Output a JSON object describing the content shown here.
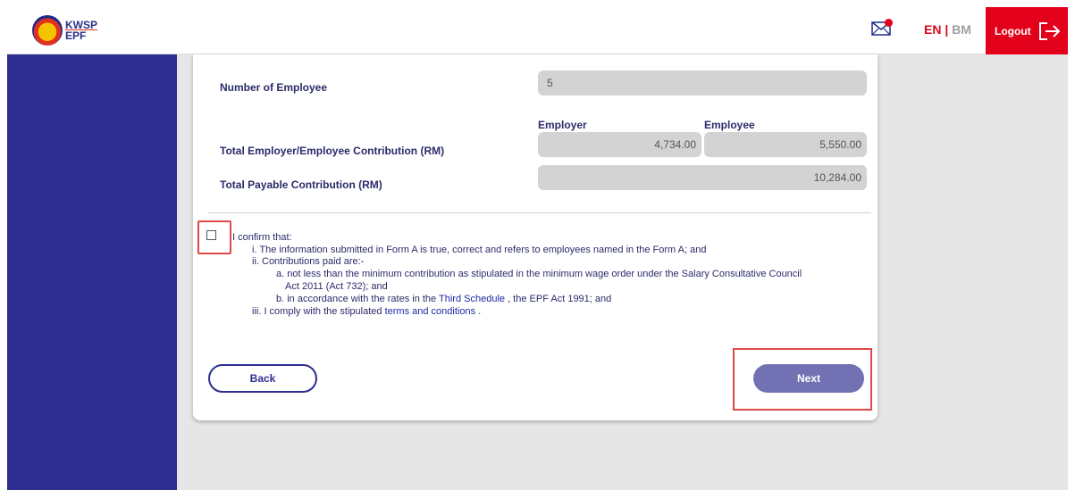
{
  "header": {
    "logo_line1": "KWSP",
    "logo_line2": "EPF",
    "lang_en": "EN",
    "lang_sep": "|",
    "lang_bm": "BM",
    "logout_label": "Logout"
  },
  "form": {
    "num_employee_label": "Number of Employee",
    "num_employee_value": "5",
    "col_employer": "Employer",
    "col_employee": "Employee",
    "total_contrib_label": "Total Employer/Employee Contribution (RM)",
    "employer_value": "4,734.00",
    "employee_value": "5,550.00",
    "payable_label": "Total Payable Contribution (RM)",
    "payable_value": "10,284.00"
  },
  "confirm": {
    "heading": "I confirm that:",
    "i": "i. The information submitted in Form A is true, correct and refers to employees named in the Form A; and",
    "ii": "ii. Contributions paid are:-",
    "a1": "a. not less than the minimum contribution as stipulated in the minimum wage order under the Salary Consultative Council",
    "a2": "Act 2011 (Act 732); and",
    "b_pre": "b. in accordance with the rates in the ",
    "b_link": "Third Schedule",
    "b_post": " , the EPF Act 1991; and",
    "iii_pre": "iii. I comply with the stipulated ",
    "iii_link": "terms and conditions",
    "iii_post": " ."
  },
  "buttons": {
    "back": "Back",
    "next": "Next"
  },
  "colors": {
    "brand_red": "#e3001b",
    "sidebar_blue": "#2d2d8f",
    "next_button": "#7171b3"
  }
}
